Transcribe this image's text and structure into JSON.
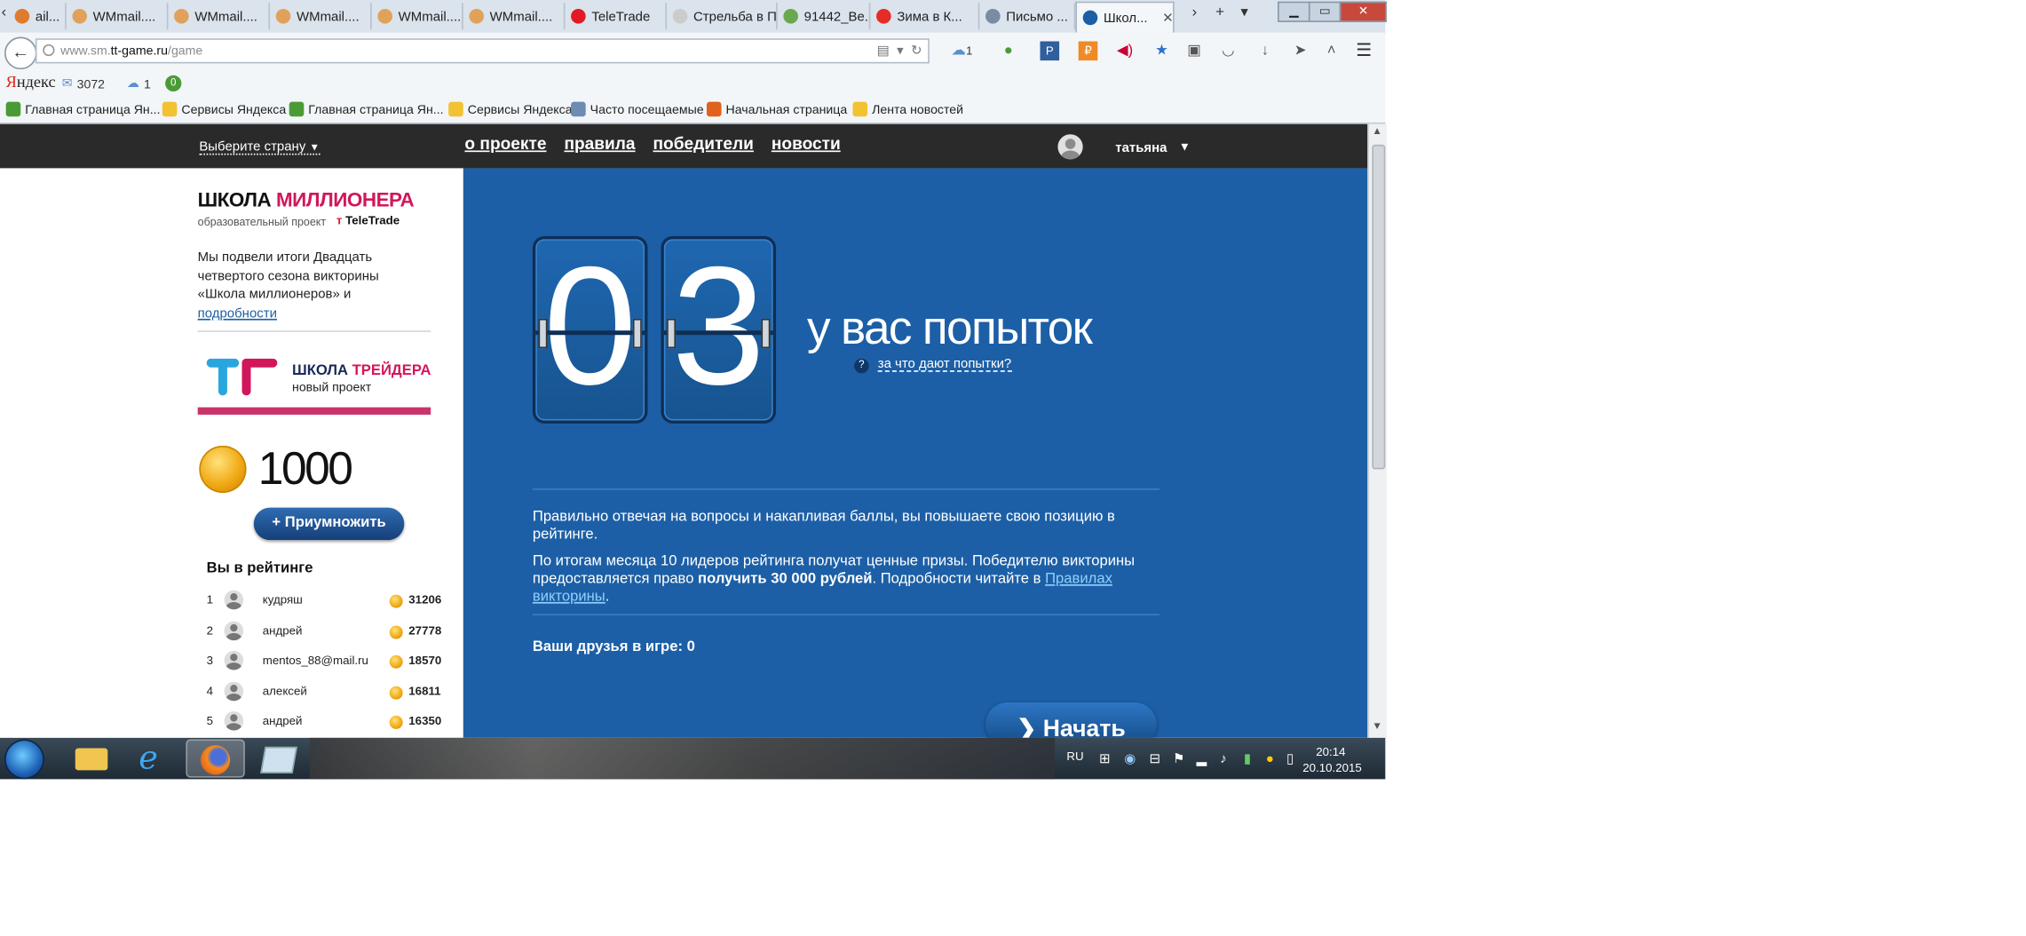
{
  "browser": {
    "tabs": [
      {
        "label": "ail...",
        "color": "#e07b2d"
      },
      {
        "label": "WMmail....",
        "color": "#e0a25a"
      },
      {
        "label": "WMmail....",
        "color": "#e0a25a"
      },
      {
        "label": "WMmail....",
        "color": "#e0a25a"
      },
      {
        "label": "WMmail....",
        "color": "#e0a25a"
      },
      {
        "label": "WMmail....",
        "color": "#e0a25a"
      },
      {
        "label": "TeleTrade",
        "color": "#e21a24"
      },
      {
        "label": "Стрельба в П...",
        "color": "#cccccc"
      },
      {
        "label": "91442_Ве...",
        "color": "#6aa84f"
      },
      {
        "label": "Зима в К...",
        "color": "#e52d27"
      },
      {
        "label": "Письмо ...",
        "color": "#7a8ca3"
      },
      {
        "label": "Школ...",
        "color": "#1c5fa6"
      }
    ],
    "url_prefix": "www.sm.",
    "url_domain": "tt-game.ru",
    "url_path": "/game",
    "toolbar_weather": "1"
  },
  "yandex_bar": {
    "logo_first": "Я",
    "logo_rest": "ндекс",
    "mail_count": "3072",
    "weather": "1",
    "badge": "0"
  },
  "bookmarks": [
    {
      "label": "Главная страница Ян...",
      "color": "#4a9b36"
    },
    {
      "label": "Сервисы Яндекса",
      "color": "#f1c232"
    },
    {
      "label": "Главная страница Ян...",
      "color": "#4a9b36"
    },
    {
      "label": "Сервисы Яндекса",
      "color": "#f1c232"
    },
    {
      "label": "Часто посещаемые",
      "color": "#6d8bb3"
    },
    {
      "label": "Начальная страница",
      "color": "#e0621d"
    },
    {
      "label": "Лента новостей",
      "color": "#f1c232"
    }
  ],
  "site": {
    "country_select": "Выберите страну",
    "nav": [
      "о проекте",
      "правила",
      "победители",
      "новости"
    ],
    "user_name": "татьяна"
  },
  "left": {
    "logo_word1": "ШКОЛА ",
    "logo_word2": "МИЛЛИОНЕРА",
    "logo_sub": "образовательный проект",
    "teletrade_a": "Tele",
    "teletrade_b": "Trade",
    "note_text": "Мы подвели итоги Двадцать четвертого сезона викторины «Школа миллионеров» и ",
    "note_link": "подробности",
    "trader_word1": "ШКОЛА ",
    "trader_word2": "ТРЕЙДЕРА",
    "trader_sub": "новый проект",
    "score": "1000",
    "multiply_button": "+ Приумножить",
    "rating_title": "Вы в рейтинге",
    "rating": [
      {
        "rank": "1",
        "name": "кудряш",
        "score": "31206"
      },
      {
        "rank": "2",
        "name": "андрей",
        "score": "27778"
      },
      {
        "rank": "3",
        "name": "mentos_88@mail.ru",
        "score": "18570"
      },
      {
        "rank": "4",
        "name": "алексей",
        "score": "16811"
      },
      {
        "rank": "5",
        "name": "андрей",
        "score": "16350"
      }
    ]
  },
  "main": {
    "digit1": "0",
    "digit2": "3",
    "attempts_label": "у вас попыток",
    "help_icon": "?",
    "why_link": "за что дают попытки?",
    "para1": "Правильно отвечая на вопросы и накапливая баллы, вы повышаете свою позицию в рейтинге.",
    "para2_a": "По итогам месяца 10 лидеров рейтинга получат ценные призы. Победителю викторины предоставляется право ",
    "para2_bold": "получить 30 000 рублей",
    "para2_b": ". Подробности читайте в ",
    "para2_link": "Правилах викторины",
    "para2_c": ".",
    "friends": "Ваши друзья в игре: 0",
    "start_button": "Начать"
  },
  "taskbar": {
    "lang": "RU",
    "time": "20:14",
    "date": "20.10.2015"
  },
  "colors": {
    "main_blue": "#1c5fa6",
    "brand_pink": "#d2165c",
    "top_bar": "#2a2a2a"
  }
}
